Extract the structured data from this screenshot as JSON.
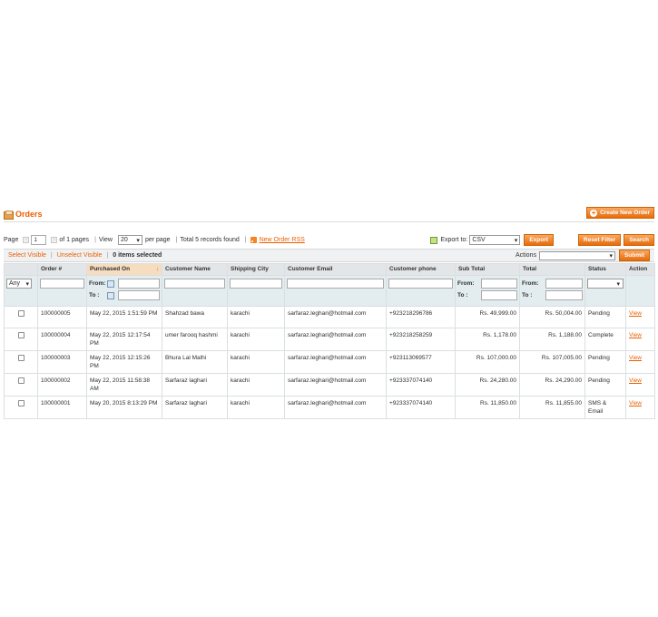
{
  "header": {
    "title": "Orders",
    "create_button": "Create New Order"
  },
  "pager": {
    "page_label": "Page",
    "page_value": "1",
    "of_pages": "of 1 pages",
    "view_label": "View",
    "view_value": "20",
    "per_page": "per page",
    "total": "Total 5 records found",
    "rss_link": "New Order RSS",
    "export_label": "Export to:",
    "export_value": "CSV",
    "export_button": "Export",
    "reset_button": "Reset Filter",
    "search_button": "Search"
  },
  "massaction": {
    "select_visible": "Select Visible",
    "unselect_visible": "Unselect Visible",
    "items_selected": "0 items selected",
    "actions_label": "Actions",
    "submit_button": "Submit"
  },
  "columns": [
    "",
    "Order #",
    "Purchased On",
    "Customer Name",
    "Shipping City",
    "Customer Email",
    "Customer phone",
    "Sub Total",
    "Total",
    "Status",
    "Action"
  ],
  "filters": {
    "any": "Any",
    "from": "From:",
    "to": "To :",
    "from2": "From:",
    "to2": "To :",
    "from3": "From:",
    "to3": "To :"
  },
  "rows": [
    {
      "order": "100000005",
      "date": "May 22, 2015 1:51:59 PM",
      "name": "Shahzad bawa",
      "city": "karachi",
      "email": "sarfaraz.leghari@hotmail.com",
      "phone": "+923218296786",
      "subtotal": "Rs. 49,999.00",
      "total": "Rs. 50,004.00",
      "status": "Pending",
      "action": "View"
    },
    {
      "order": "100000004",
      "date": "May 22, 2015 12:17:54 PM",
      "name": "umer farooq hashmi",
      "city": "karachi",
      "email": "sarfaraz.leghari@hotmail.com",
      "phone": "+923218258259",
      "subtotal": "Rs. 1,178.00",
      "total": "Rs. 1,188.00",
      "status": "Complete",
      "action": "View"
    },
    {
      "order": "100000003",
      "date": "May 22, 2015 12:15:26 PM",
      "name": "Bhura Lal Malhi",
      "city": "karachi",
      "email": "sarfaraz.leghari@hotmail.com",
      "phone": "+923113069577",
      "subtotal": "Rs. 107,000.00",
      "total": "Rs. 107,005.00",
      "status": "Pending",
      "action": "View"
    },
    {
      "order": "100000002",
      "date": "May 22, 2015 11:58:38 AM",
      "name": "Sarfaraz laghari",
      "city": "karachi",
      "email": "sarfaraz.leghari@hotmail.com",
      "phone": "+923337074140",
      "subtotal": "Rs. 24,280.00",
      "total": "Rs. 24,290.00",
      "status": "Pending",
      "action": "View"
    },
    {
      "order": "100000001",
      "date": "May 20, 2015 8:13:29 PM",
      "name": "Sarfaraz laghari",
      "city": "karachi",
      "email": "sarfaraz.leghari@hotmail.com",
      "phone": "+923337074140",
      "subtotal": "Rs. 11,850.00",
      "total": "Rs. 11,855.00",
      "status": "SMS & Email",
      "action": "View"
    }
  ]
}
